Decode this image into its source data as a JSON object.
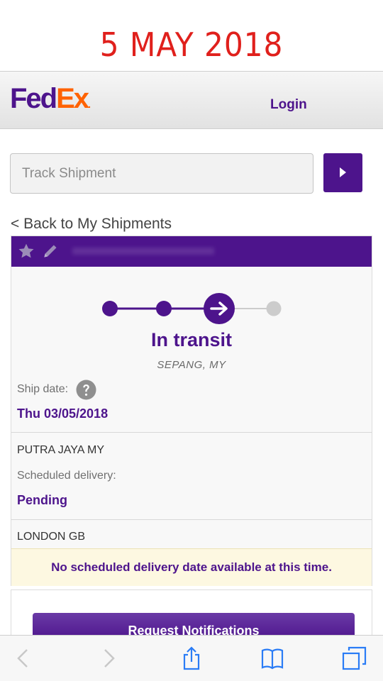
{
  "caption": {
    "date": "5 MAY 2018"
  },
  "header": {
    "logo_fed": "Fed",
    "logo_ex": "Ex",
    "logo_dot": ".",
    "login_label": "Login"
  },
  "search": {
    "placeholder": "Track Shipment",
    "button_icon": "triangle-right-icon"
  },
  "nav": {
    "back_label": "< Back to My Shipments"
  },
  "shipment": {
    "toolbar_icons": [
      "star-icon",
      "pencil-icon"
    ],
    "progress": {
      "total_steps": 4,
      "current_step": 3
    },
    "status": "In transit",
    "location": "SEPANG, MY",
    "ship_date_label": "Ship date:",
    "ship_date": "Thu 03/05/2018",
    "origin": "PUTRA JAYA MY",
    "scheduled_label": "Scheduled delivery:",
    "scheduled_value": "Pending",
    "destination": "LONDON GB",
    "notice": "No scheduled delivery date available at this time."
  },
  "actions": {
    "request_notifications": "Request Notifications"
  },
  "browser_toolbar": {
    "icons": [
      "back-arrow-icon",
      "forward-arrow-icon",
      "share-icon",
      "bookmarks-icon",
      "tabs-icon"
    ]
  },
  "colors": {
    "brand_purple": "#4d148c",
    "brand_orange": "#ff6200",
    "caption_red": "#e0201c",
    "notice_bg": "#fdf8e1"
  }
}
